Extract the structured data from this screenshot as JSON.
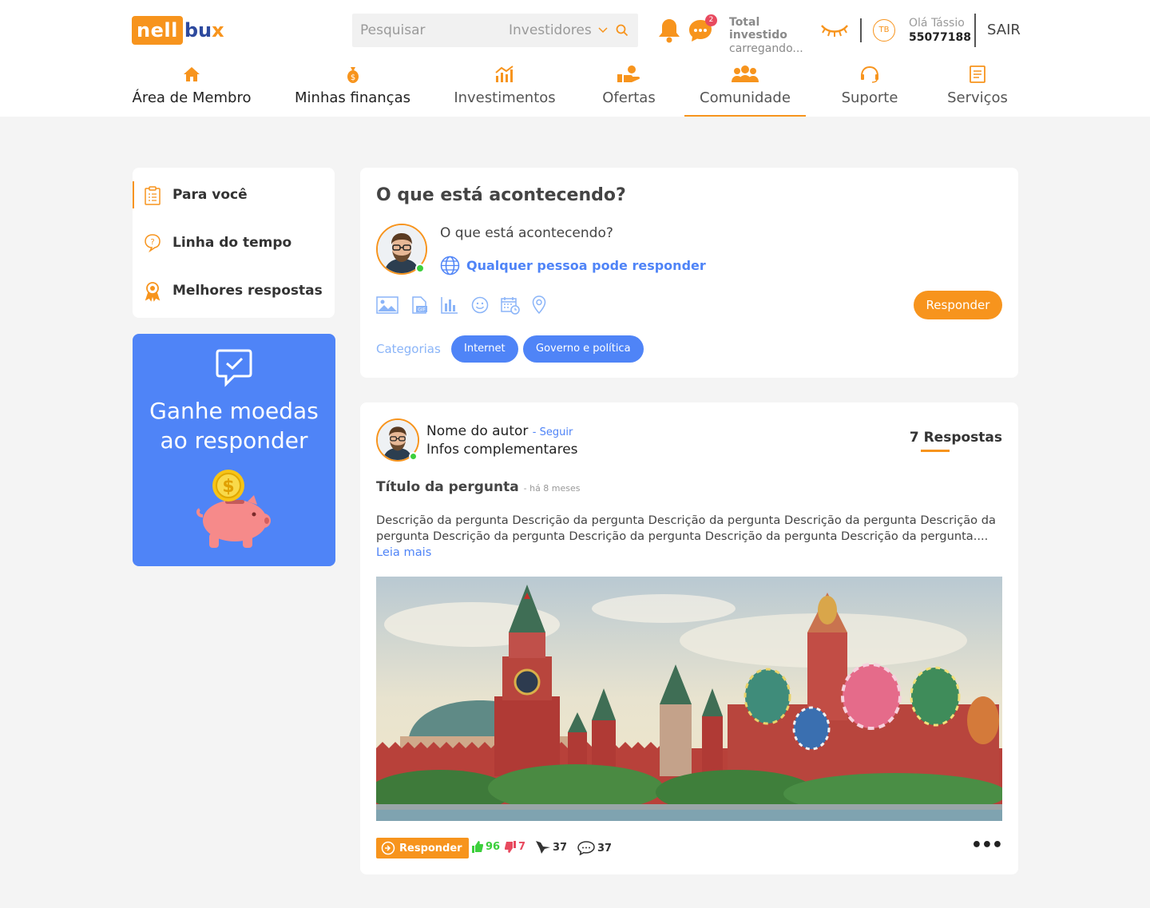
{
  "header": {
    "logo": {
      "part1": "nell",
      "part2": "bu",
      "part3": "x"
    },
    "search": {
      "placeholder": "Pesquisar",
      "filter": "Investidores"
    },
    "notifications": {
      "messages_badge": "2"
    },
    "invested": {
      "title": "Total investido",
      "value": "carregando..."
    },
    "user": {
      "initials": "TB",
      "greeting": "Olá Tássio",
      "id": "55077188"
    },
    "logout_label": "SAIR"
  },
  "nav": {
    "items": [
      {
        "label": "Área de Membro",
        "icon": "home-icon"
      },
      {
        "label": "Minhas finanças",
        "icon": "money-bag-icon"
      },
      {
        "label": "Investimentos",
        "icon": "chart-growth-icon"
      },
      {
        "label": "Ofertas",
        "icon": "hand-coin-icon"
      },
      {
        "label": "Comunidade",
        "icon": "community-icon",
        "active": true
      },
      {
        "label": "Suporte",
        "icon": "headset-icon"
      },
      {
        "label": "Serviços",
        "icon": "document-icon"
      }
    ]
  },
  "sidebar": {
    "items": [
      {
        "label": "Para você",
        "icon": "clipboard-icon",
        "active": true
      },
      {
        "label": "Linha do tempo",
        "icon": "question-bubble-icon"
      },
      {
        "label": "Melhores respostas",
        "icon": "award-icon"
      }
    ],
    "promo": {
      "line1": "Ganhe moedas",
      "line2": "ao responder",
      "icon": "chat-check-icon",
      "image": "piggy-bank-coin-icon"
    }
  },
  "composer": {
    "title": "O que está acontecendo?",
    "placeholder": "O que está acontecendo?",
    "reply_scope": "Qualquer pessoa pode responder",
    "tools": [
      "image-icon",
      "gif-icon",
      "poll-icon",
      "emoji-icon",
      "schedule-icon",
      "location-icon"
    ],
    "submit_label": "Responder",
    "categories_label": "Categorias",
    "categories": [
      "Internet",
      "Governo e política"
    ]
  },
  "post": {
    "author_name": "Nome do autor",
    "follow_label": "- Seguir",
    "author_info": "Infos complementares",
    "answers_label": "7 Respostas",
    "title": "Título da pergunta",
    "time": "- há 8 meses",
    "description": "Descrição da pergunta Descrição da pergunta Descrição da pergunta Descrição da pergunta Descrição da pergunta Descrição da pergunta Descrição da pergunta Descrição da pergunta Descrição da pergunta....",
    "read_more": "Leia mais",
    "answer_button": "Responder",
    "likes": "96",
    "dislikes": "7",
    "shares": "37",
    "comments": "37",
    "colors": {
      "accent": "#f7941d",
      "blue": "#4f84f7",
      "like": "#3ccf3c",
      "dislike": "#e84a5f"
    }
  }
}
